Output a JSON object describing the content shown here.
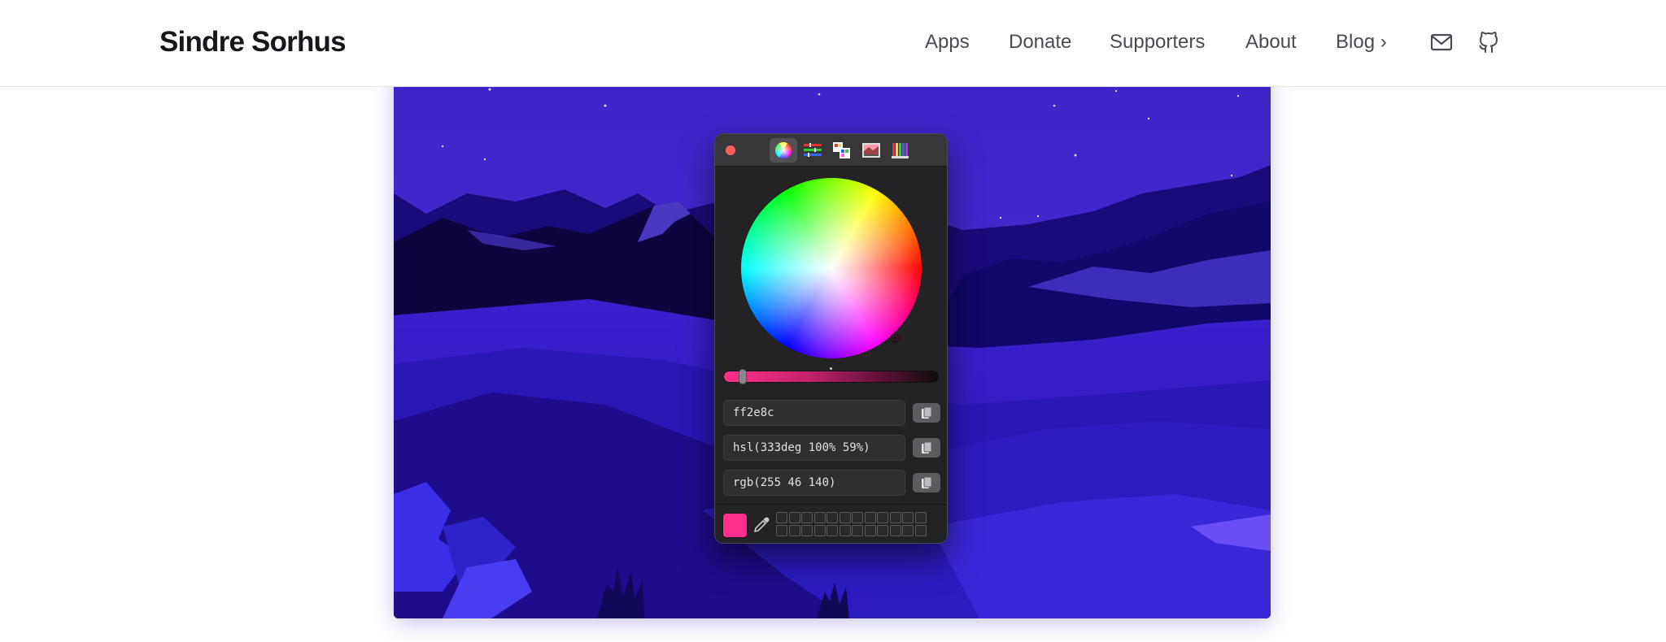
{
  "header": {
    "logo": "Sindre Sorhus",
    "nav": [
      {
        "label": "Apps"
      },
      {
        "label": "Donate"
      },
      {
        "label": "Supporters"
      },
      {
        "label": "About"
      },
      {
        "label": "Blog ›"
      }
    ],
    "icons": [
      "mail-icon",
      "github-icon"
    ]
  },
  "picker": {
    "modes": [
      "color-wheel-icon",
      "sliders-icon",
      "palettes-icon",
      "image-palette-icon",
      "pencils-icon"
    ],
    "active_mode": "color-wheel-icon",
    "brightness_level": 0.07,
    "fields": [
      {
        "value": "ff2e8c"
      },
      {
        "value": "hsl(333deg 100% 59%)"
      },
      {
        "value": "rgb(255 46 140)"
      }
    ],
    "current_color": "#ff2e8c",
    "accent": "#ff2e8c",
    "swatch_slots": 24
  }
}
